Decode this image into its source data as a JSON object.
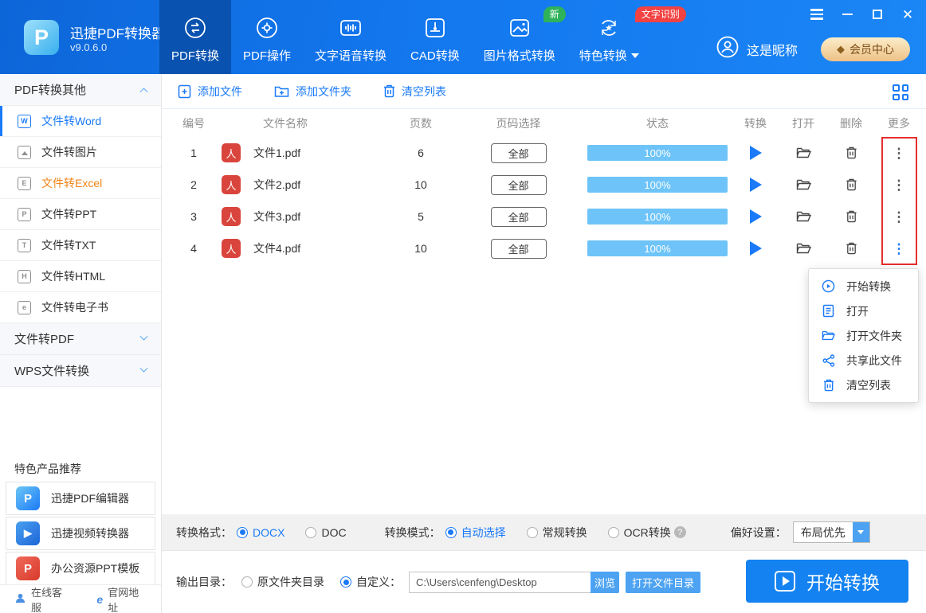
{
  "app": {
    "name": "迅捷PDF转换器",
    "version": "v9.0.6.0"
  },
  "header": {
    "tabs": [
      {
        "label": "PDF转换"
      },
      {
        "label": "PDF操作"
      },
      {
        "label": "文字语音转换"
      },
      {
        "label": "CAD转换"
      },
      {
        "label": "图片格式转换",
        "badge": "新"
      },
      {
        "label": "特色转换",
        "badge": "文字识别"
      }
    ],
    "nickname": "这是昵称",
    "vip_label": "会员中心"
  },
  "sidebar": {
    "sections": [
      {
        "title": "PDF转换其他"
      },
      {
        "title": "文件转PDF"
      },
      {
        "title": "WPS文件转换"
      }
    ],
    "items": [
      {
        "label": "文件转Word",
        "letter": "W"
      },
      {
        "label": "文件转图片"
      },
      {
        "label": "文件转Excel",
        "letter": "E"
      },
      {
        "label": "文件转PPT",
        "letter": "P"
      },
      {
        "label": "文件转TXT",
        "letter": "T"
      },
      {
        "label": "文件转HTML",
        "letter": "H"
      },
      {
        "label": "文件转电子书",
        "letter": "e"
      }
    ],
    "promo_title": "特色产品推荐",
    "products": [
      {
        "label": "迅捷PDF编辑器",
        "initial": "P"
      },
      {
        "label": "迅捷视频转换器",
        "initial": "▶"
      },
      {
        "label": "办公资源PPT模板",
        "initial": "P"
      }
    ],
    "footer_links": [
      {
        "label": "在线客服"
      },
      {
        "label": "官网地址"
      }
    ]
  },
  "toolbar": {
    "add_file": "添加文件",
    "add_folder": "添加文件夹",
    "clear_list": "清空列表"
  },
  "table": {
    "headers": [
      "编号",
      "文件名称",
      "页数",
      "页码选择",
      "状态",
      "转换",
      "打开",
      "删除",
      "更多"
    ],
    "rows": [
      {
        "number": "1",
        "filename": "文件1.pdf",
        "pages": "6",
        "page_select": "全部",
        "progress": "100%"
      },
      {
        "number": "2",
        "filename": "文件2.pdf",
        "pages": "10",
        "page_select": "全部",
        "progress": "100%"
      },
      {
        "number": "3",
        "filename": "文件3.pdf",
        "pages": "5",
        "page_select": "全部",
        "progress": "100%"
      },
      {
        "number": "4",
        "filename": "文件4.pdf",
        "pages": "10",
        "page_select": "全部",
        "progress": "100%"
      }
    ]
  },
  "context_menu": {
    "items": [
      {
        "label": "开始转换"
      },
      {
        "label": "打开"
      },
      {
        "label": "打开文件夹"
      },
      {
        "label": "共享此文件"
      },
      {
        "label": "清空列表"
      }
    ]
  },
  "settings": {
    "format_label": "转换格式：",
    "format_options": [
      {
        "label": "DOCX",
        "selected": true
      },
      {
        "label": "DOC",
        "selected": false
      }
    ],
    "mode_label": "转换模式：",
    "mode_options": [
      {
        "label": "自动选择",
        "selected": true
      },
      {
        "label": "常规转换",
        "selected": false
      },
      {
        "label": "OCR转换",
        "selected": false
      }
    ],
    "pref_label": "偏好设置：",
    "pref_value": "布局优先"
  },
  "output": {
    "label": "输出目录：",
    "option_source": "原文件夹目录",
    "option_custom": "自定义：",
    "path": "C:\\Users\\cenfeng\\Desktop",
    "browse": "浏览",
    "open_dir": "打开文件目录",
    "start": "开始转换"
  },
  "colors": {
    "header_blue": "#1377ee",
    "active_tab_blue": "#0a52b0",
    "accent_blue": "#1a7af8",
    "progress_blue": "#6ec4f8",
    "excel_orange": "#f08519",
    "badge_red": "#f24242",
    "badge_green": "#2fb35a",
    "highlight_red": "#e62e2e",
    "vip_gold": "#edc186"
  }
}
